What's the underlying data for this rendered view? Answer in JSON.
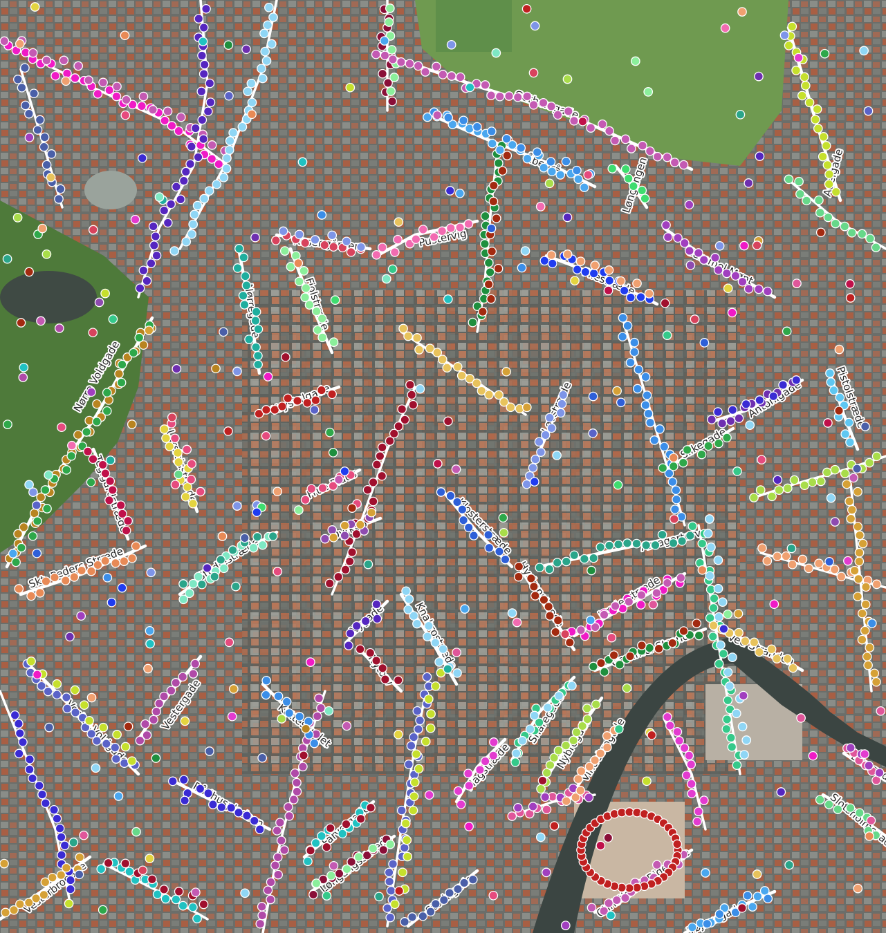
{
  "map": {
    "base_layer": "aerial-orthophoto",
    "colors": {
      "street": "#ffffff",
      "park": "#5f8f4a",
      "lake": "#3f4a44",
      "point_outline": "#ffffff"
    },
    "street_names": [
      "Gothersgade",
      "Åbenrå",
      "Løngangen",
      "Adelgade",
      "Rosengården",
      "Pustervig",
      "Gammel Mønt",
      "Pilestræde",
      "Nørregade",
      "Fiolstræde",
      "Nørre Voldgade",
      "Krystalgade",
      "Løvstræde",
      "Antonigade",
      "Pistolstræde",
      "Silkegade",
      "Larslejsstræde",
      "Teglgårdstræde",
      "Frue Plads",
      "Dyrkøb",
      "Klosterstræde",
      "Amagertorv",
      "Studiestræde",
      "Skt. Peders Stræde",
      "Hyskenstræde",
      "Læderstræde",
      "Nygade",
      "Knabrostræde",
      "Gammel Strand",
      "Ved Stranden",
      "Nytorv",
      "Vester Voldgade",
      "Vestergade",
      "Kattesundet",
      "Snaregade",
      "Nybrogade",
      "Vindebrogade",
      "Børsgade",
      "Magstræde",
      "Rådhuspladsen",
      "Farvergade",
      "Slotsholmsgade",
      "Vesterbrogade",
      "Løngangsstræde",
      "Storingade",
      "Christiansb Ridebane",
      "Tøjhusgade"
    ],
    "point_colors": [
      "#f01ac6",
      "#e33bd0",
      "#a13fbf",
      "#8e4bb0",
      "#b04aa8",
      "#c45ab3",
      "#6e2fb0",
      "#5526c0",
      "#3a2bd4",
      "#1f3cf0",
      "#2e5fd8",
      "#3b8ee8",
      "#4aa7ef",
      "#5fc7f2",
      "#8fd6f5",
      "#20c2c2",
      "#1fae9e",
      "#2aa58a",
      "#35c98a",
      "#3fdc6f",
      "#2ea84a",
      "#1e8f3e",
      "#67d88a",
      "#8bef9b",
      "#7ee8c4",
      "#a9dd4a",
      "#c6e02d",
      "#e4d440",
      "#e8c35c",
      "#d6a136",
      "#b88420",
      "#e88a56",
      "#f0a070",
      "#d8435d",
      "#c0104a",
      "#a0102e",
      "#8a0f38",
      "#c02020",
      "#a32a10",
      "#e0569a",
      "#f26bb1",
      "#e64b7e",
      "#5a63c8",
      "#4a5fa8",
      "#7e95e8"
    ]
  }
}
